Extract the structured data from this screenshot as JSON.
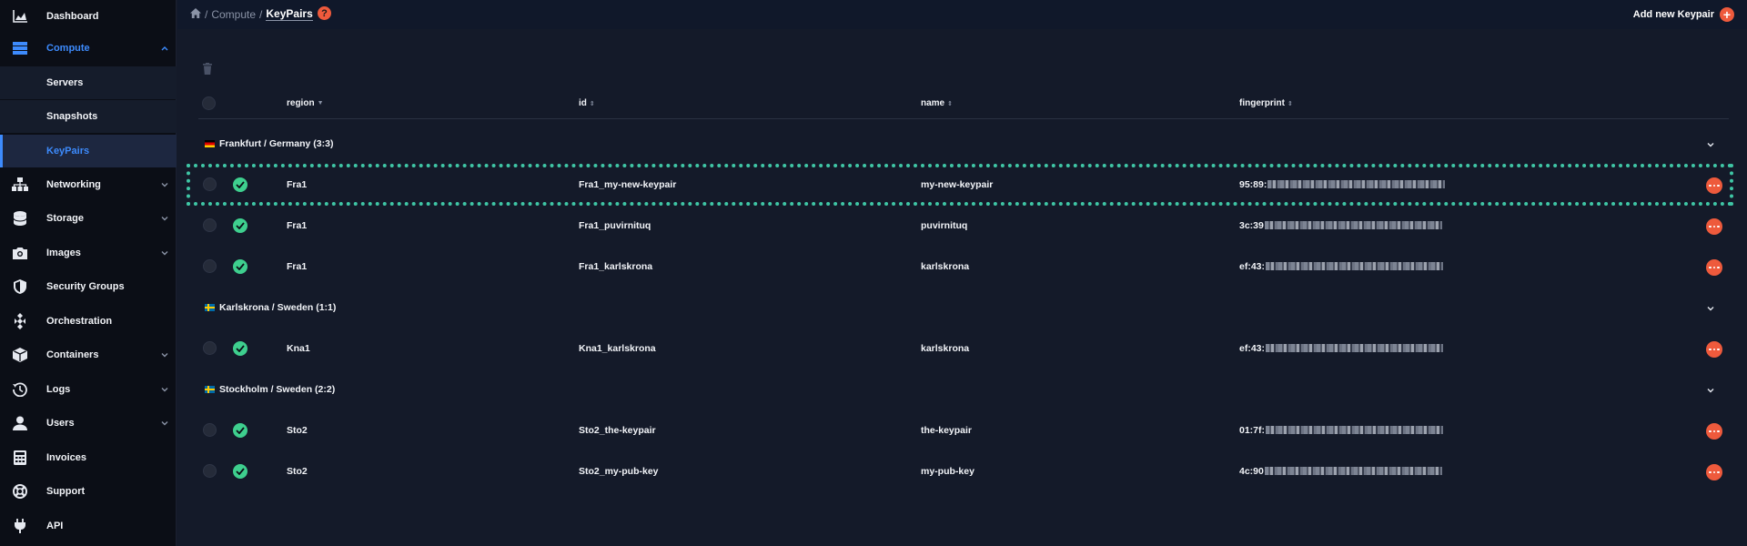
{
  "sidebar": {
    "items": [
      {
        "label": "Dashboard"
      },
      {
        "label": "Compute"
      },
      {
        "label": "Servers"
      },
      {
        "label": "Snapshots"
      },
      {
        "label": "KeyPairs"
      },
      {
        "label": "Networking"
      },
      {
        "label": "Storage"
      },
      {
        "label": "Images"
      },
      {
        "label": "Security Groups"
      },
      {
        "label": "Orchestration"
      },
      {
        "label": "Containers"
      },
      {
        "label": "Logs"
      },
      {
        "label": "Users"
      },
      {
        "label": "Invoices"
      },
      {
        "label": "Support"
      },
      {
        "label": "API"
      }
    ]
  },
  "header": {
    "breadcrumb": [
      "Compute",
      "KeyPairs"
    ],
    "help_label": "?",
    "add_label": "Add new Keypair",
    "add_plus": "+"
  },
  "table": {
    "columns": [
      "region",
      "id",
      "name",
      "fingerprint"
    ],
    "groups": [
      {
        "label": "Frankfurt / Germany (3:3)"
      },
      {
        "label": "Karlskrona / Sweden (1:1)"
      },
      {
        "label": "Stockholm / Sweden (2:2)"
      }
    ],
    "rows": [
      {
        "region": "Fra1",
        "id": "Fra1_my-new-keypair",
        "name": "my-new-keypair",
        "fingerprint": "95:89:"
      },
      {
        "region": "Fra1",
        "id": "Fra1_puvirnituq",
        "name": "puvirnituq",
        "fingerprint": "3c:39"
      },
      {
        "region": "Fra1",
        "id": "Fra1_karlskrona",
        "name": "karlskrona",
        "fingerprint": "ef:43:"
      },
      {
        "region": "Kna1",
        "id": "Kna1_karlskrona",
        "name": "karlskrona",
        "fingerprint": "ef:43:"
      },
      {
        "region": "Sto2",
        "id": "Sto2_the-keypair",
        "name": "the-keypair",
        "fingerprint": "01:7f:"
      },
      {
        "region": "Sto2",
        "id": "Sto2_my-pub-key",
        "name": "my-pub-key",
        "fingerprint": "4c:90"
      }
    ]
  },
  "colors": {
    "accent": "#3d8bfd",
    "action": "#ee5a3c",
    "success": "#3ecf8e",
    "highlight": "#3fc6a5"
  }
}
